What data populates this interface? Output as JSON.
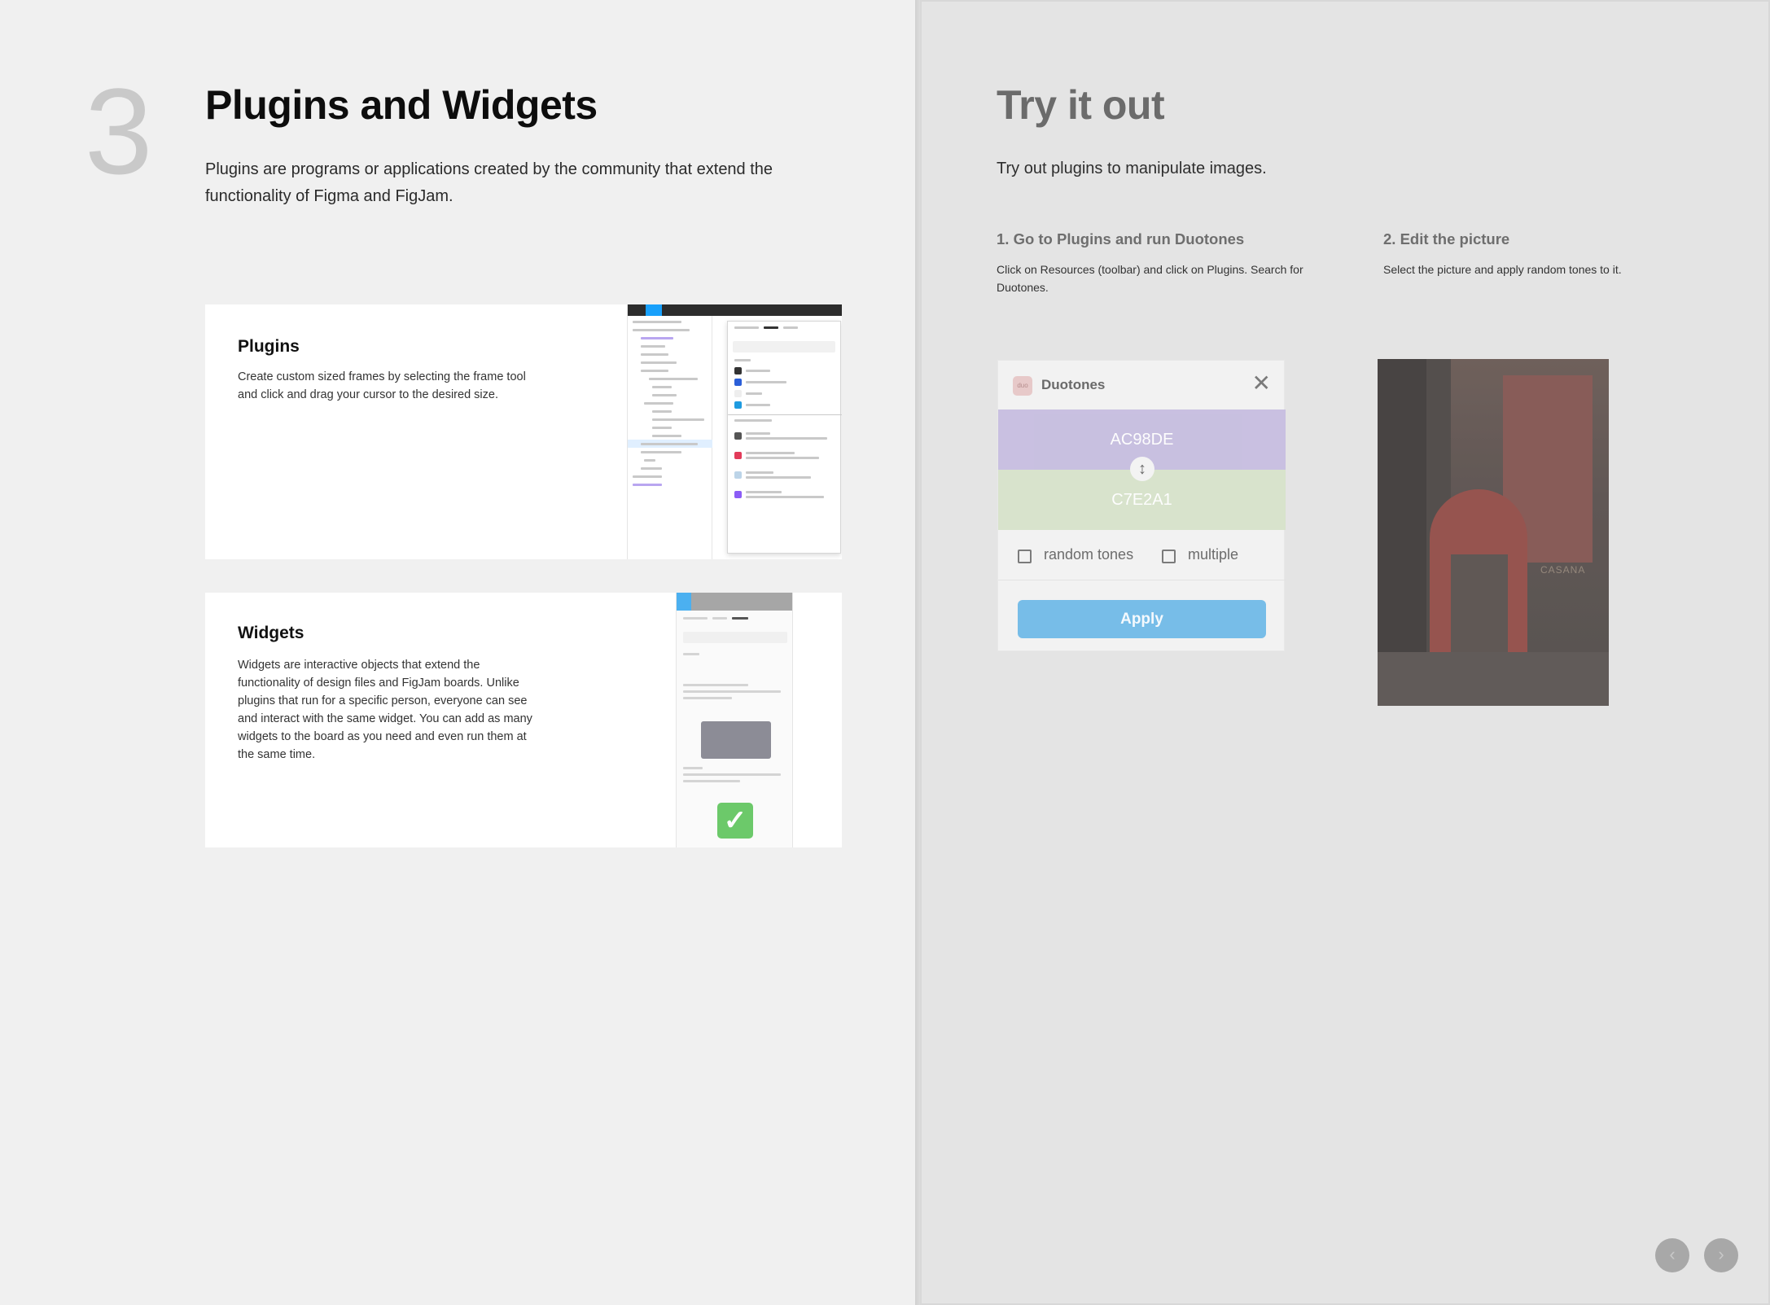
{
  "lesson": {
    "number": "3",
    "title": "Plugins and Widgets",
    "description": "Plugins are programs or applications created by the community that extend the functionality of Figma and FigJam."
  },
  "cards": {
    "plugins": {
      "title": "Plugins",
      "text": "Create custom sized frames by selecting the frame tool and click and drag your cursor to the desired size."
    },
    "widgets": {
      "title": "Widgets",
      "text": "Widgets are interactive objects that extend the functionality of design files and FigJam boards. Unlike plugins that run for a specific person, everyone can see and interact with the same widget. You can add as many widgets to the board as you need and even run them at the same time."
    }
  },
  "try": {
    "title": "Try it out",
    "description": "Try out plugins to manipulate images.",
    "steps": [
      {
        "title": "1. Go to Plugins and run Duotones",
        "text": "Click on Resources (toolbar) and click on Plugins. Search for Duotones."
      },
      {
        "title": "2. Edit the picture",
        "text": "Select the picture and apply random tones to it."
      }
    ]
  },
  "duotones": {
    "logo": "duo",
    "title": "Duotones",
    "close": "✕",
    "color1": "AC98DE",
    "color2": "C7E2A1",
    "swap_icon": "↕",
    "option1": "random tones",
    "option2": "multiple",
    "apply": "Apply"
  },
  "photo": {
    "sign": "CASANA"
  },
  "nav": {
    "prev": "‹",
    "next": "›"
  },
  "colors": {
    "accent": "#77bde8",
    "swatch1": "#c5bcdf",
    "swatch2": "#d6e2c9"
  }
}
